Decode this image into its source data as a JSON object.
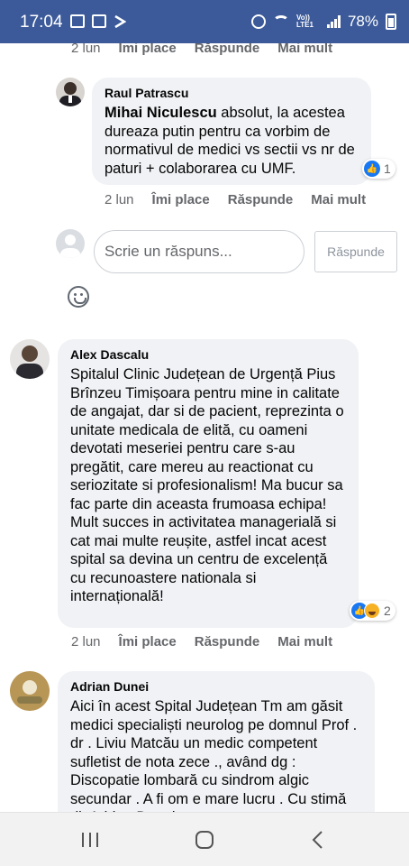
{
  "status_bar": {
    "time": "17:04",
    "battery": "78%",
    "network": "Vo)) LTE1",
    "icons": [
      "image-icon",
      "gallery-icon",
      "check-icon",
      "alarm-icon",
      "wifi-icon",
      "signal-icon",
      "battery-icon"
    ]
  },
  "top_meta": {
    "time": "2 lun",
    "like": "Îmi place",
    "reply": "Răspunde",
    "more": "Mai mult"
  },
  "comments": [
    {
      "author": "Raul Patrascu",
      "mention": "Mihai Niculescu",
      "text": " absolut, la acestea dureaza putin pentru ca vorbim de normativul de medici vs sectii vs nr de paturi + colaborarea cu UMF.",
      "reaction_count": "1",
      "meta": {
        "time": "2 lun",
        "like": "Îmi place",
        "reply": "Răspunde",
        "more": "Mai mult"
      }
    },
    {
      "author": "Alex Dascalu",
      "text": "Spitalul Clinic Județean de Urgență Pius Brînzeu Timișoara pentru mine in calitate de angajat, dar si de pacient, reprezinta o unitate medicala de elită, cu oameni devotati meseriei pentru care s-au pregătit, care mereu au reactionat cu seriozitate si profesionalism! Ma bucur sa fac parte din aceasta frumoasa echipa! Mult succes in activitatea managerială si cat mai multe reușite, astfel incat acest spital sa devina un centru de excelență cu recunoastere nationala si internațională!",
      "reaction_count": "2",
      "meta": {
        "time": "2 lun",
        "like": "Îmi place",
        "reply": "Răspunde",
        "more": "Mai mult"
      }
    },
    {
      "author": "Adrian Dunei",
      "text": "Aici în acest Spital Județean Tm am găsit medici specialiști neurolog pe domnul Prof . dr . Liviu Matcău un medic competent sufletist de nota zece ., având dg : Discopatie lombară cu sindrom algic secundar . A fi om e mare lucru . Cu stimă dl. Adrian Dunei"
    }
  ],
  "reply_box": {
    "placeholder": "Scrie un răspuns...",
    "button": "Răspunde"
  },
  "colors": {
    "status_bar": "#3c5a9a",
    "bubble": "#f0f2f5",
    "like_blue": "#1877f2"
  }
}
